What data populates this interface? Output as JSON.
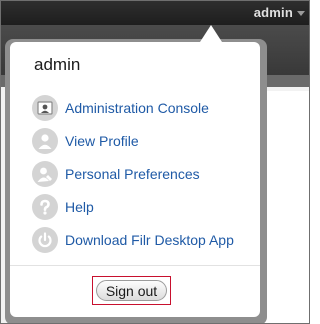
{
  "header": {
    "username": "admin"
  },
  "user_menu": {
    "title": "admin",
    "items": [
      {
        "label": "Administration Console",
        "icon": "admin-console-icon"
      },
      {
        "label": "View Profile",
        "icon": "user-profile-icon"
      },
      {
        "label": "Personal Preferences",
        "icon": "user-settings-icon"
      },
      {
        "label": "Help",
        "icon": "help-icon"
      },
      {
        "label": "Download Filr Desktop App",
        "icon": "power-icon"
      }
    ],
    "sign_out_label": "Sign out"
  },
  "colors": {
    "link": "#1f5aa6",
    "highlight_border": "#c8102e",
    "topbar": "#2e2e2e"
  }
}
